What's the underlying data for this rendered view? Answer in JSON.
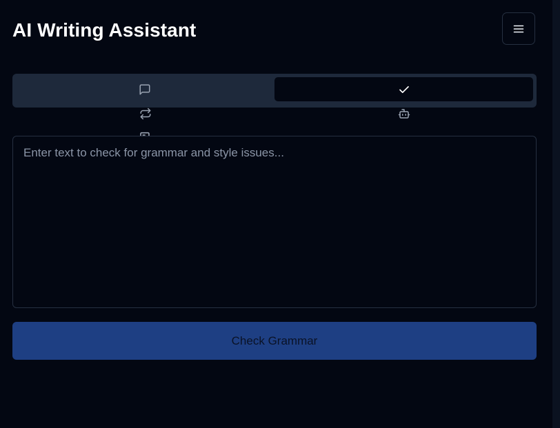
{
  "header": {
    "title": "AI Writing Assistant",
    "menu_icon": "menu-icon"
  },
  "tabs": [
    {
      "icon": "message-square-icon",
      "selected": false
    },
    {
      "icon": "check-icon",
      "selected": true
    },
    {
      "icon": "repeat-icon",
      "selected": false
    },
    {
      "icon": "bot-icon",
      "selected": false
    },
    {
      "icon": "newspaper-icon",
      "selected": false
    }
  ],
  "editor": {
    "value": "",
    "placeholder": "Enter text to check for grammar and style issues..."
  },
  "actions": {
    "check_label": "Check Grammar"
  },
  "colors": {
    "background": "#030712",
    "tab_bar": "#1e293b",
    "border": "#263041",
    "primary_button": "#1e3f83"
  }
}
